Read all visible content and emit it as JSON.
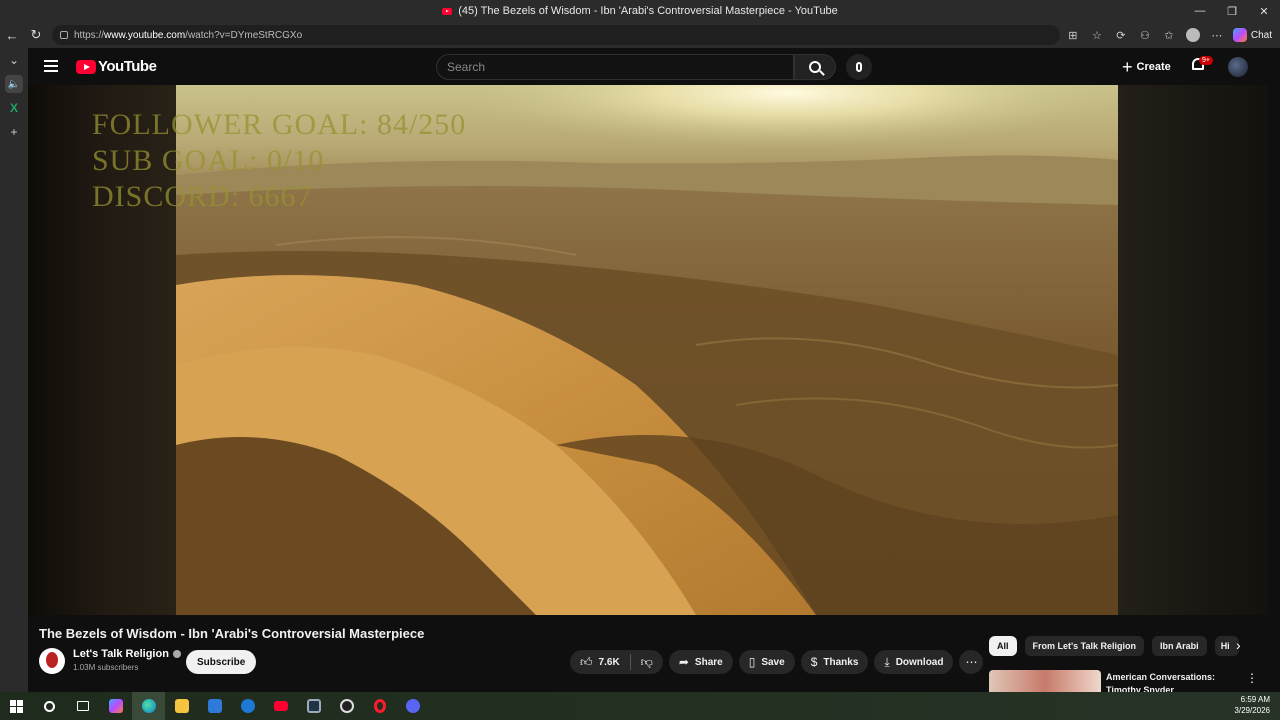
{
  "window": {
    "title": "(45) The Bezels of Wisdom - Ibn 'Arabi's Controversial Masterpiece - YouTube",
    "controls": [
      "—",
      "❐",
      "✕"
    ]
  },
  "browser": {
    "url_prefix": "https://",
    "url_host": "www.youtube.com",
    "url_path": "/watch?v=DYmeStRCGXo",
    "chat_label": "Chat"
  },
  "youtube": {
    "logo_text": "YouTube",
    "search_placeholder": "Search",
    "create_label": "Create",
    "notification_badge": "9+"
  },
  "video": {
    "overlay_lines": [
      "FOLLOWER GOAL:  84/250",
      "SUB GOAL: 0/10",
      "DISCORD: 6667"
    ],
    "title": "The Bezels of Wisdom - Ibn 'Arabi's Controversial Masterpiece"
  },
  "channel": {
    "name": "Let's Talk Religion",
    "subscribers": "1.03M subscribers",
    "subscribe_label": "Subscribe"
  },
  "actions": {
    "likes": "7.6K",
    "share": "Share",
    "save": "Save",
    "thanks": "Thanks",
    "download": "Download"
  },
  "chips": [
    "All",
    "From Let's Talk Religion",
    "Ibn Arabi",
    "Hi"
  ],
  "recommendation": {
    "title": "American Conversations: Timothy Snyder"
  },
  "taskbar": {
    "time": "6:59 AM",
    "date": "3/29/2026"
  },
  "colors": {
    "youtube_red": "#ff0033",
    "background": "#0f0f0f",
    "accent_chip": "#f1f1f1"
  }
}
